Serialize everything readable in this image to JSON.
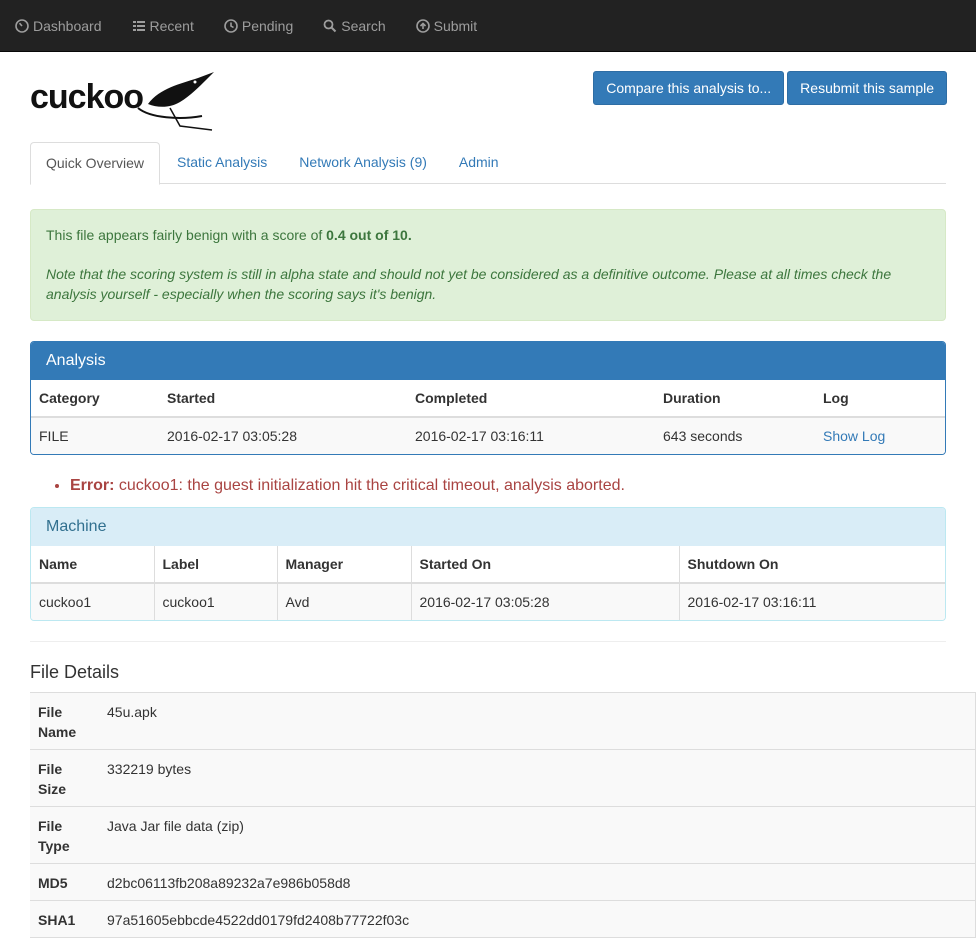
{
  "nav": [
    {
      "label": "Dashboard",
      "icon": "dashboard-icon"
    },
    {
      "label": "Recent",
      "icon": "list-icon"
    },
    {
      "label": "Pending",
      "icon": "clock-icon"
    },
    {
      "label": "Search",
      "icon": "search-icon"
    },
    {
      "label": "Submit",
      "icon": "upload-icon"
    }
  ],
  "logo_text": "cuckoo",
  "buttons": {
    "compare": "Compare this analysis to...",
    "resubmit": "Resubmit this sample"
  },
  "tabs": [
    "Quick Overview",
    "Static Analysis",
    "Network Analysis (9)",
    "Admin"
  ],
  "alert": {
    "prefix": "This file appears fairly benign with a score of ",
    "score": "0.4 out of 10.",
    "note": "Note that the scoring system is still in alpha state and should not yet be considered as a definitive outcome. Please at all times check the analysis yourself - especially when the scoring says it's benign."
  },
  "analysis": {
    "title": "Analysis",
    "headers": [
      "Category",
      "Started",
      "Completed",
      "Duration",
      "Log"
    ],
    "row": [
      "FILE",
      "2016-02-17 03:05:28",
      "2016-02-17 03:16:11",
      "643 seconds",
      "Show Log"
    ]
  },
  "error": {
    "label": "Error:",
    "text": " cuckoo1: the guest initialization hit the critical timeout, analysis aborted."
  },
  "machine": {
    "title": "Machine",
    "headers": [
      "Name",
      "Label",
      "Manager",
      "Started On",
      "Shutdown On"
    ],
    "row": [
      "cuckoo1",
      "cuckoo1",
      "Avd",
      "2016-02-17 03:05:28",
      "2016-02-17 03:16:11"
    ]
  },
  "file_details": {
    "title": "File Details",
    "rows": [
      {
        "key": "File Name",
        "value": "45u.apk"
      },
      {
        "key": "File Size",
        "value": "332219 bytes"
      },
      {
        "key": "File Type",
        "value": "Java Jar file data (zip)"
      },
      {
        "key": "MD5",
        "value": "d2bc06113fb208a89232a7e986b058d8"
      },
      {
        "key": "SHA1",
        "value": "97a51605ebbcde4522dd0179fd2408b77722f03c"
      }
    ]
  },
  "colors": {
    "primary": "#337ab7",
    "success_bg": "#dff0d8",
    "danger": "#a94442",
    "info_bg": "#d9edf7"
  }
}
